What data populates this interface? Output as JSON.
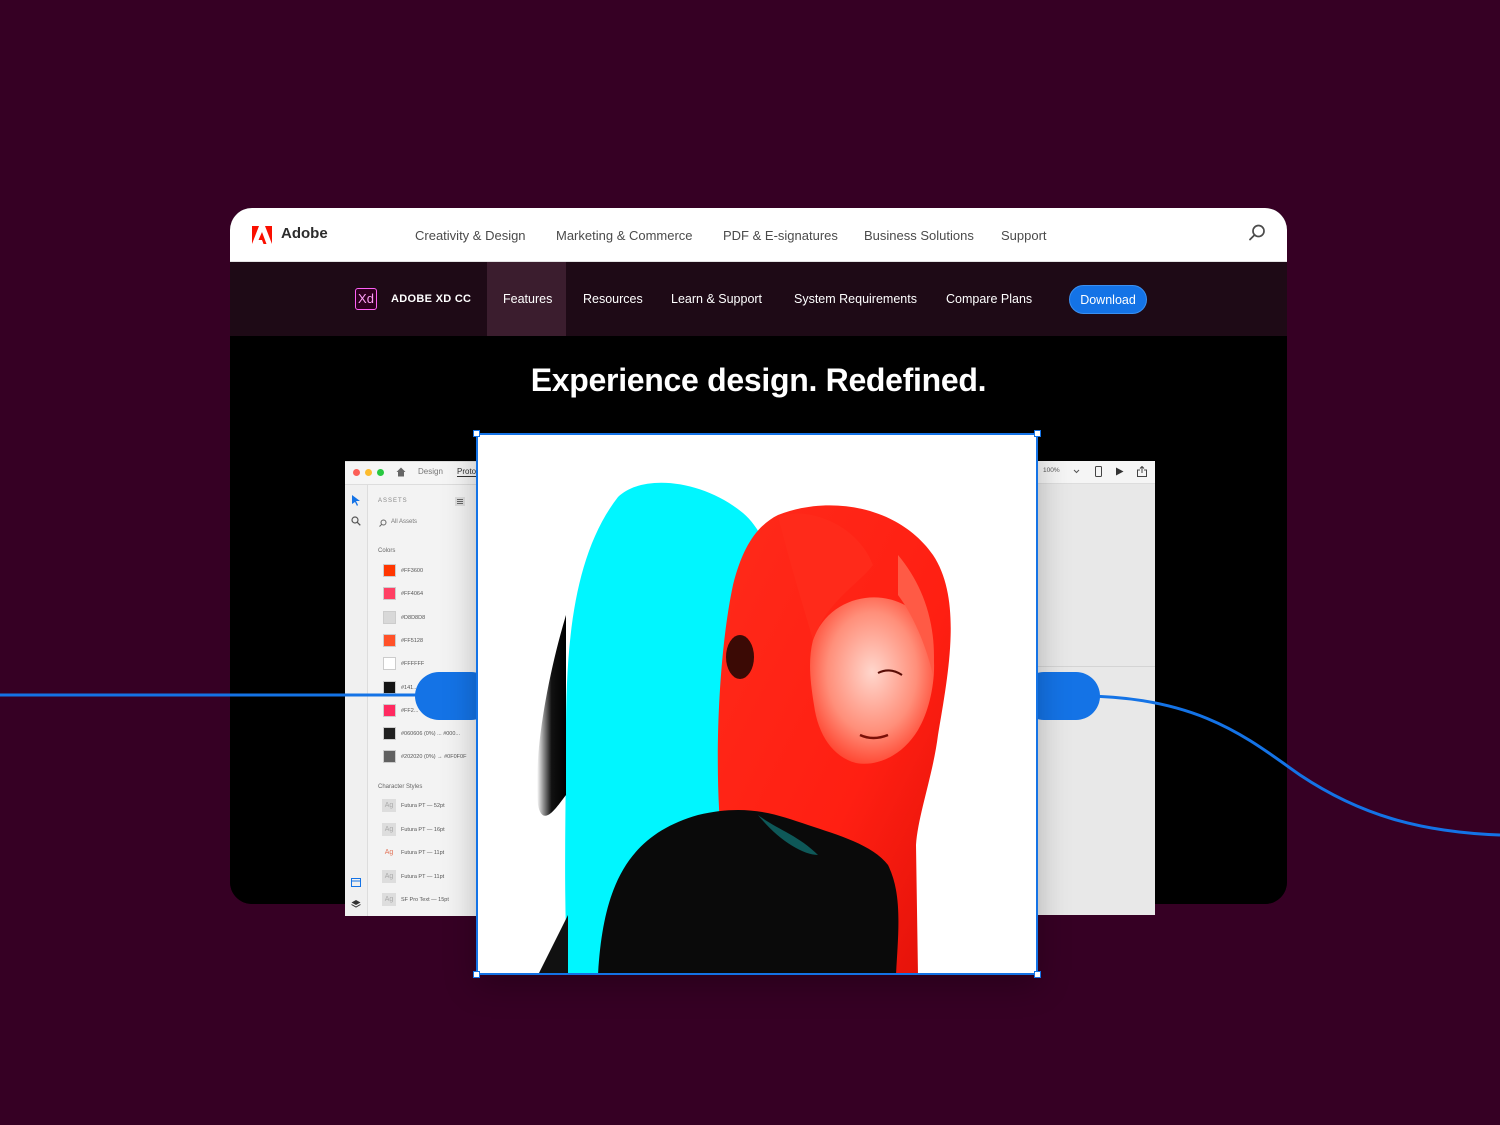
{
  "colors": {
    "background": "#360024",
    "accent": "#1473e6",
    "adobe_red": "#fa0f00",
    "xd_pink": "#ff61f6"
  },
  "topnav": {
    "brand": "Adobe",
    "links": [
      "Creativity & Design",
      "Marketing & Commerce",
      "PDF & E-signatures",
      "Business Solutions",
      "Support"
    ],
    "search_icon": "search-icon"
  },
  "subnav": {
    "badge": "Xd",
    "product": "ADOBE XD CC",
    "tabs": [
      "Features",
      "Resources",
      "Learn & Support",
      "System Requirements",
      "Compare Plans"
    ],
    "active_tab": "Features",
    "download": "Download"
  },
  "hero": {
    "headline": "Experience design. Redefined."
  },
  "app": {
    "tabs": [
      "Design",
      "Proto"
    ],
    "assets_label": "ASSETS",
    "search_placeholder": "All Assets",
    "colors_label": "Colors",
    "swatches": [
      {
        "hex": "#FF3600",
        "color": "#ff3600"
      },
      {
        "hex": "#FF4064",
        "color": "#ff4064"
      },
      {
        "hex": "#D8D8D8",
        "color": "#d8d8d8"
      },
      {
        "hex": "#FF5128",
        "color": "#ff5128"
      },
      {
        "hex": "#FFFFFF",
        "color": "#ffffff"
      },
      {
        "hex": "#141...",
        "color": "#141414"
      },
      {
        "hex": "#FF2...",
        "color": "#ff2a60"
      },
      {
        "hex": "#060606 (0%) ... #000...",
        "color": "#202020"
      },
      {
        "hex": "#202020 (0%) → #0F0F0F",
        "color": "#606060"
      }
    ],
    "char_label": "Character Styles",
    "char_styles": [
      "Futura PT — 52pt",
      "Futura PT — 16pt",
      "Futura PT — 11pt",
      "Futura PT — 11pt",
      "SF Pro Text — 15pt"
    ],
    "char_glyph": "Ag",
    "zoom": "100%"
  }
}
